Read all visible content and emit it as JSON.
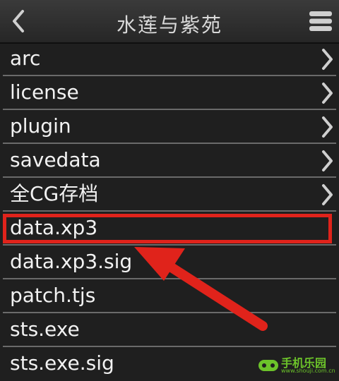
{
  "header": {
    "title": "水莲与紫苑",
    "back_icon": "chevron-left-icon",
    "menu_icon": "menu-icon"
  },
  "files": [
    {
      "name": "arc",
      "type": "folder"
    },
    {
      "name": "license",
      "type": "folder"
    },
    {
      "name": "plugin",
      "type": "folder"
    },
    {
      "name": "savedata",
      "type": "folder"
    },
    {
      "name": "全CG存档",
      "type": "folder"
    },
    {
      "name": "data.xp3",
      "type": "file",
      "highlighted": true
    },
    {
      "name": "data.xp3.sig",
      "type": "file"
    },
    {
      "name": "patch.tjs",
      "type": "file"
    },
    {
      "name": "sts.exe",
      "type": "file"
    },
    {
      "name": "sts.exe.sig",
      "type": "file"
    }
  ],
  "annotation": {
    "color": "#e0231b"
  },
  "watermark": {
    "text": "手机乐园",
    "sub": "www.shouji.com.cn",
    "color": "#6cc32a"
  }
}
